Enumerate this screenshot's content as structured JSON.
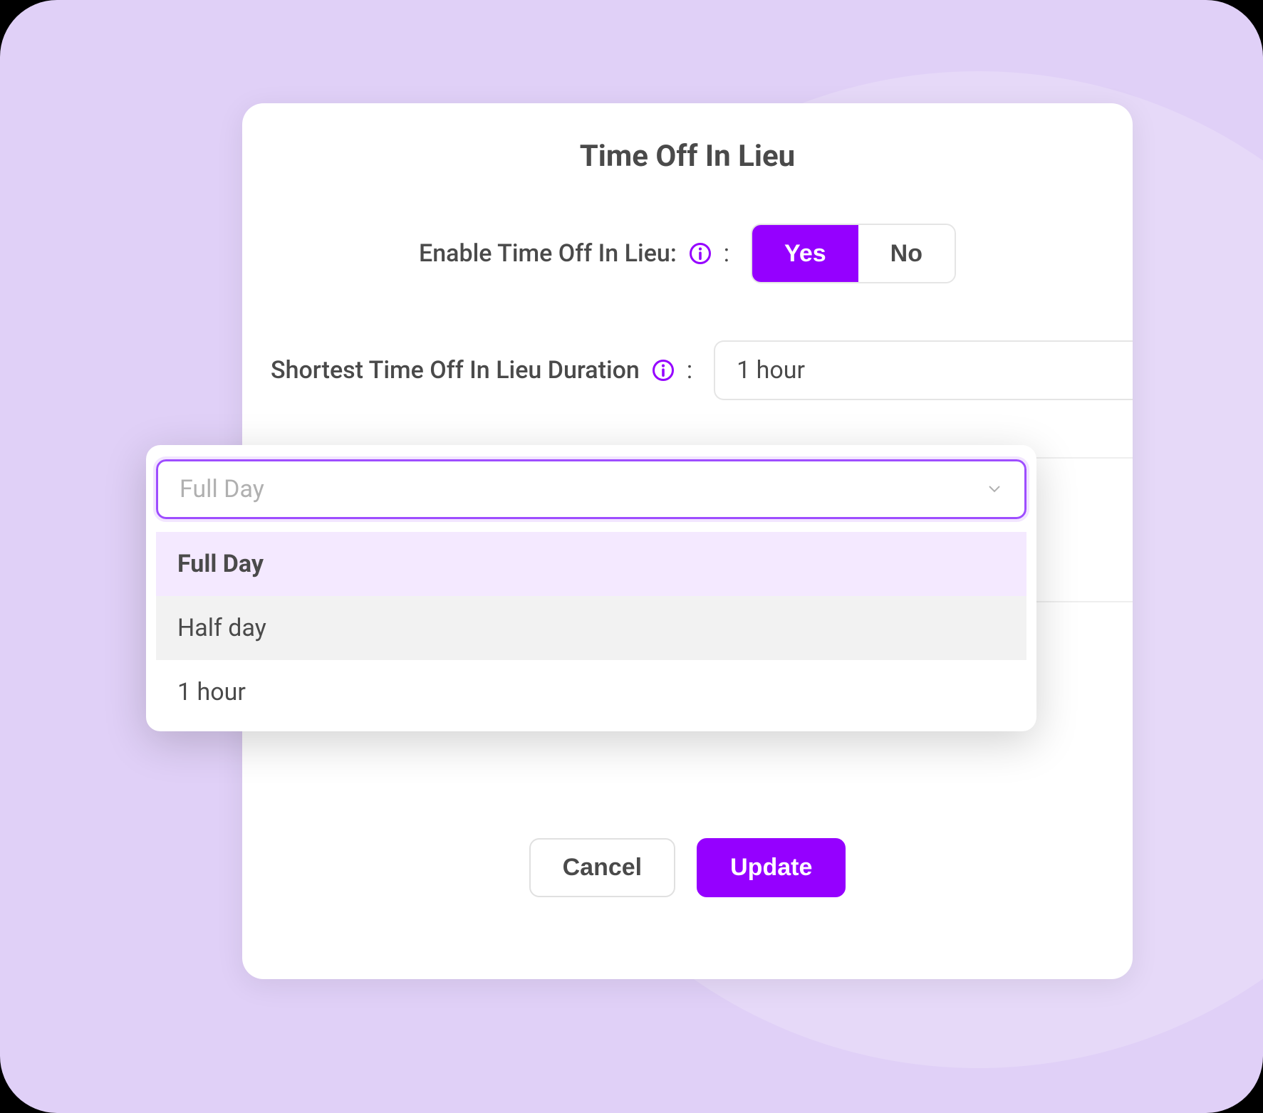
{
  "card": {
    "title": "Time Off In Lieu",
    "enable_label": "Enable Time Off In Lieu:",
    "shortest_label": "Shortest Time Off In Lieu Duration",
    "shortest_value": "1 hour",
    "yes_label": "Yes",
    "no_label": "No",
    "cancel_label": "Cancel",
    "update_label": "Update"
  },
  "dropdown": {
    "placeholder": "Full Day",
    "options": [
      "Full Day",
      "Half day",
      "1 hour"
    ],
    "selected_index": 0,
    "hover_index": 1
  },
  "colors": {
    "accent": "#9500ff",
    "panel_bg": "#e0d0f7"
  }
}
